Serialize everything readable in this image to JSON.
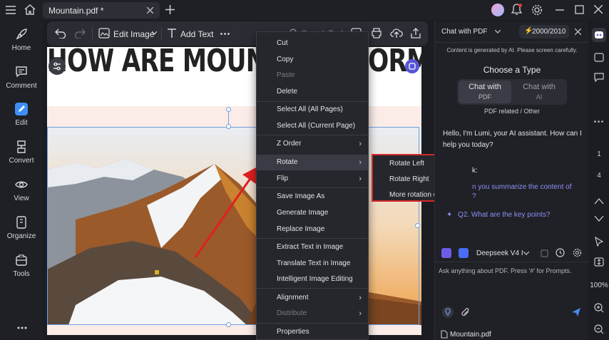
{
  "tab": {
    "title": "Mountain.pdf *"
  },
  "sidebar": {
    "items": [
      {
        "label": "Home",
        "icon": "rocket-icon"
      },
      {
        "label": "Comment",
        "icon": "comment-icon"
      },
      {
        "label": "Edit",
        "icon": "edit-icon"
      },
      {
        "label": "Convert",
        "icon": "convert-icon"
      },
      {
        "label": "View",
        "icon": "eye-icon"
      },
      {
        "label": "Organize",
        "icon": "organize-icon"
      },
      {
        "label": "Tools",
        "icon": "toolbox-icon"
      }
    ]
  },
  "toolbar": {
    "edit_image_label": "Edit Image",
    "add_text_label": "Add Text",
    "search_placeholder": "Search Tools"
  },
  "document": {
    "heading": "HOW ARE MOUNTAINS FORMED?"
  },
  "context_menu": {
    "items": [
      {
        "label": "Cut"
      },
      {
        "label": "Copy"
      },
      {
        "label": "Paste"
      },
      {
        "label": "Delete"
      },
      {
        "label": "Select All (All Pages)"
      },
      {
        "label": "Select All (Current Page)"
      },
      {
        "label": "Z Order"
      },
      {
        "label": "Rotate"
      },
      {
        "label": "Flip"
      },
      {
        "label": "Save Image As"
      },
      {
        "label": "Generate Image"
      },
      {
        "label": "Replace Image"
      },
      {
        "label": "Extract Text in Image"
      },
      {
        "label": "Translate Text in Image"
      },
      {
        "label": "Intelligent Image Editing"
      },
      {
        "label": "Alignment"
      },
      {
        "label": "Distribute"
      },
      {
        "label": "Properties"
      }
    ]
  },
  "rotate_submenu": {
    "items": [
      {
        "label": "Rotate Left"
      },
      {
        "label": "Rotate Right"
      },
      {
        "label": "More rotation options"
      }
    ]
  },
  "chat": {
    "header_label": "Chat with PDF",
    "credits": "2000/2010",
    "notice": "Content is generated by AI. Please screen carefully.",
    "choose_type": "Choose a Type",
    "type_pdf_line1": "Chat with",
    "type_pdf_line2": "PDF",
    "type_ai_line1": "Chat with",
    "type_ai_line2": "AI",
    "category": "PDF related / Other",
    "greeting": "Hello, I'm Lumi, your AI assistant. How can I help you today?",
    "partial_label": "k:",
    "suggestion1": "n you summarize the content of",
    "suggestion1_tail": "?",
    "suggestion2": "Q2. What are the key points?",
    "model": "Deepseek V4 I",
    "input_placeholder": "Ask anything about PDF. Press '#' for Prompts.",
    "file": "Mountain.pdf"
  },
  "rail": {
    "page1": "1",
    "page2": "4",
    "zoom": "100%"
  },
  "colors": {
    "accent": "#7c7cf5",
    "highlight_border": "#d32a2a",
    "arrow": "#e02020"
  }
}
